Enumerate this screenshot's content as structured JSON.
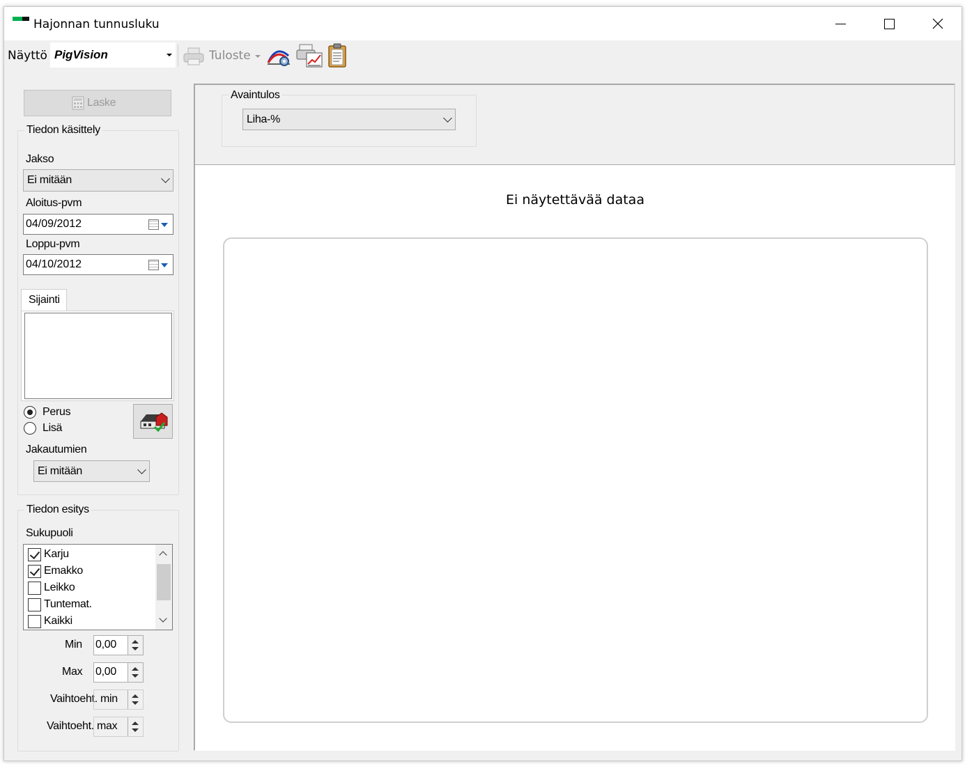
{
  "window": {
    "title": "Hajonnan tunnusluku",
    "controls": [
      "minimize-icon",
      "maximize-icon",
      "close-icon"
    ]
  },
  "toolbar": {
    "display_label": "Näyttö",
    "display_value": "PigVision",
    "print_label": "Tuloste",
    "icons": [
      "chart-settings-icon",
      "print-chart-icon",
      "clipboard-icon"
    ]
  },
  "left": {
    "calc_button": "Laske",
    "processing": {
      "title": "Tiedon käsittely",
      "period_label": "Jakso",
      "period_value": "Ei mitään",
      "start_label": "Aloitus-pvm",
      "start_value": "04/09/2012",
      "end_label": "Loppu-pvm",
      "end_value": "04/10/2012",
      "location_tab": "Sijainti",
      "radio_basic": "Perus",
      "radio_extra": "Lisä",
      "radio_selected": "Perus",
      "distribution_label": "Jakautumien",
      "distribution_value": "Ei mitään"
    },
    "presentation": {
      "title": "Tiedon esitys",
      "gender_label": "Sukupuoli",
      "genders": [
        {
          "label": "Karju",
          "checked": true
        },
        {
          "label": "Emakko",
          "checked": true
        },
        {
          "label": "Leikko",
          "checked": false
        },
        {
          "label": "Tuntemat.",
          "checked": false
        },
        {
          "label": "Kaikki",
          "checked": false
        }
      ],
      "min_label": "Min",
      "min_value": "0,00",
      "max_label": "Max",
      "max_value": "0,00",
      "alt_min_label": "Vaihtoeht. min",
      "alt_min_value": "",
      "alt_max_label": "Vaihtoeht. max",
      "alt_max_value": ""
    }
  },
  "main": {
    "key_result_title": "Avaintulos",
    "key_result_value": "Liha-%",
    "no_data_text": "Ei näytettävää dataa"
  },
  "colors": {
    "window_bg": "#f0f0f0",
    "content_bg": "#ffffff",
    "app_icon_green": "#00b050"
  }
}
